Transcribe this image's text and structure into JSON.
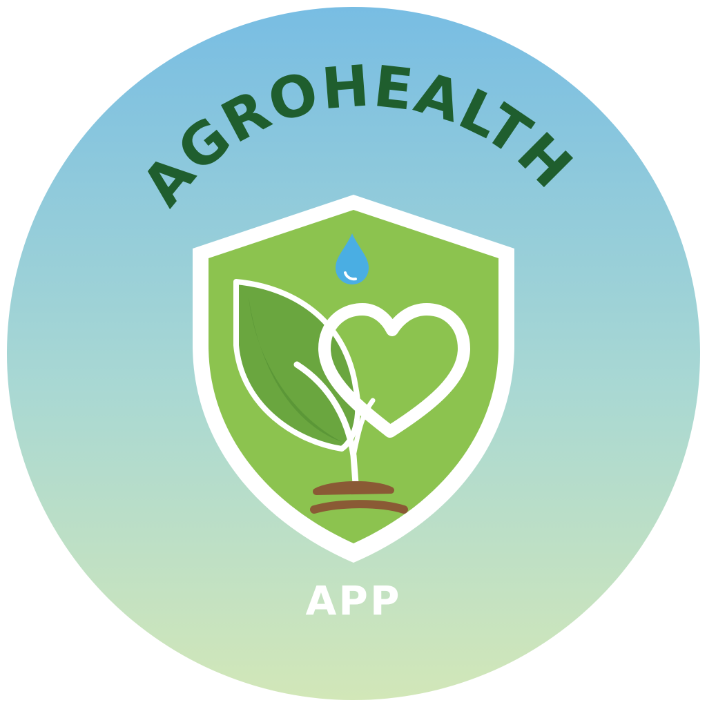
{
  "logo": {
    "brand_name": "AGROHEALTH",
    "sub_label": "APP",
    "colors": {
      "background_top": "#7cc0e2",
      "background_bottom": "#cfe6bc",
      "brand_text": "#1f5e2e",
      "sub_text": "#ffffff",
      "shield_fill": "#8cc34f",
      "shield_border": "#ffffff",
      "leaf_fill": "#6aa63f",
      "leaf_shadow": "#4f8a32",
      "water_drop": "#4aaee3",
      "soil": "#8a5a35"
    },
    "icons": [
      "shield-icon",
      "water-drop-icon",
      "leaf-icon",
      "heart-icon",
      "sprout-icon",
      "soil-icon"
    ]
  }
}
